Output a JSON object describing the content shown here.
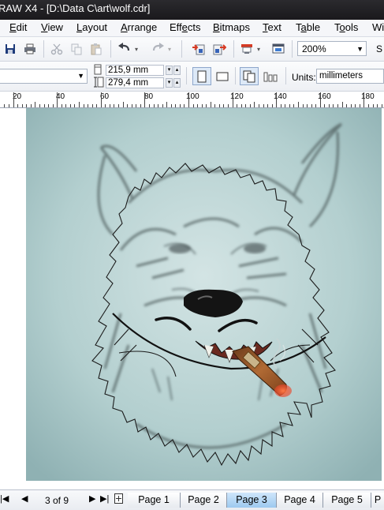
{
  "window": {
    "title": "RAW X4 - [D:\\Data C\\art\\wolf.cdr]"
  },
  "menu": {
    "items": [
      {
        "label": "Edit",
        "u": "E",
        "rest": "dit"
      },
      {
        "label": "View",
        "u": "V",
        "rest": "iew"
      },
      {
        "label": "Layout",
        "u": "L",
        "rest": "ayout"
      },
      {
        "label": "Arrange",
        "u": "A",
        "rest": "rrange"
      },
      {
        "label": "Effects",
        "pre": "Eff",
        "u": "e",
        "rest": "cts"
      },
      {
        "label": "Bitmaps",
        "u": "B",
        "rest": "itmaps"
      },
      {
        "label": "Text",
        "u": "T",
        "rest": "ext"
      },
      {
        "label": "Table",
        "pre": "T",
        "u": "a",
        "rest": "ble"
      },
      {
        "label": "Tools",
        "pre": "T",
        "u": "o",
        "rest": "ols"
      },
      {
        "label": "Wi"
      }
    ]
  },
  "toolbar": {
    "icons": [
      "save-icon",
      "print-icon",
      "cut-icon",
      "copy-icon",
      "paste-icon",
      "undo-icon",
      "redo-icon",
      "import-icon",
      "export-icon",
      "application-launcher-icon",
      "welcome-screen-icon"
    ],
    "zoom": "200%",
    "overflow_label": "S"
  },
  "property_bar": {
    "page_width": "215,9 mm",
    "page_height": "279,4 mm",
    "units_label": "Units:",
    "units_value": "millimeters"
  },
  "ruler": {
    "labels": [
      "20",
      "40",
      "60",
      "80",
      "100",
      "120",
      "140",
      "160",
      "180"
    ]
  },
  "pages": {
    "counter": "3 of 9",
    "tabs": [
      "Page 1",
      "Page 2",
      "Page 3",
      "Page 4",
      "Page 5",
      "P"
    ],
    "active_index": 2
  },
  "colors": {
    "title_bar": "#1f1e22",
    "active_tab": "#b7d9f6",
    "cigar_ember": "#e8432a"
  }
}
